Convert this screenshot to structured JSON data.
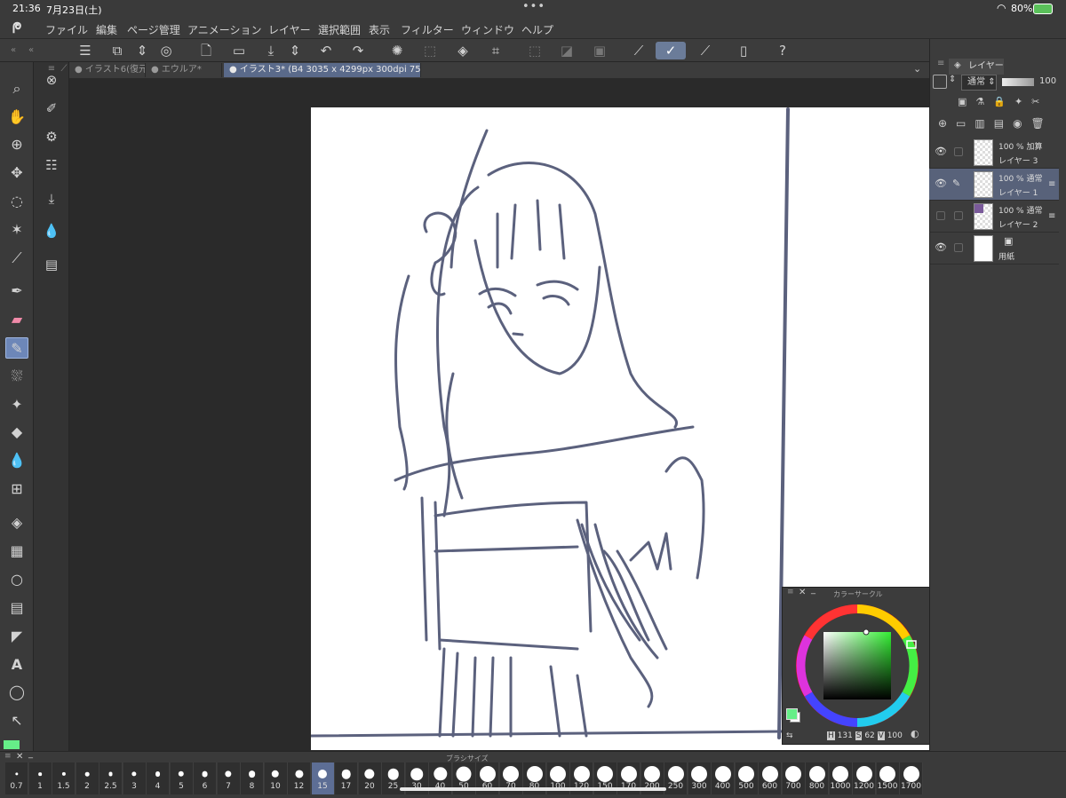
{
  "status": {
    "time": "21:36",
    "date": "7月23日(土)",
    "dots": "•••",
    "battery": "80%"
  },
  "menu": [
    "ファイル",
    "編集",
    "ページ管理",
    "アニメーション",
    "レイヤー",
    "選択範囲",
    "表示",
    "フィルター",
    "ウィンドウ",
    "ヘルプ"
  ],
  "tabs": [
    "イラスト6(復元",
    "エウルア*",
    "イラスト3* (B4 3035 x 4299px 300dpi 75.7%)"
  ],
  "layers_panel": {
    "tab_label": "レイヤー",
    "blend_mode": "通常",
    "opacity": "100",
    "layers": [
      {
        "opacity": "100 %",
        "mode": "加算",
        "name": "レイヤー 3",
        "visible": true,
        "selected": false
      },
      {
        "opacity": "100 %",
        "mode": "通常",
        "name": "レイヤー 1",
        "visible": true,
        "selected": true
      },
      {
        "opacity": "100 %",
        "mode": "通常",
        "name": "レイヤー 2",
        "visible": false,
        "selected": false
      },
      {
        "opacity": "",
        "mode": "",
        "name": "用紙",
        "visible": true,
        "selected": false
      }
    ]
  },
  "color_panel": {
    "title": "カラーサークル",
    "h_label": "H",
    "h": "131",
    "s_label": "S",
    "s": "62",
    "v_label": "V",
    "v": "100",
    "main_color": "#66ee88",
    "accent_square": "#3aa33a"
  },
  "brush_panel": {
    "title": "ブラシサイズ",
    "sizes": [
      "0.7",
      "1",
      "1.5",
      "2",
      "2.5",
      "3",
      "4",
      "5",
      "6",
      "7",
      "8",
      "10",
      "12",
      "15",
      "17",
      "20",
      "25",
      "30",
      "40",
      "50",
      "60",
      "70",
      "80",
      "100",
      "120",
      "150",
      "170",
      "200",
      "250",
      "300",
      "400",
      "500",
      "600",
      "700",
      "800",
      "1000",
      "1200",
      "1500",
      "1700"
    ],
    "selected": "15"
  },
  "icons": {
    "left_tools": [
      "zoom-icon",
      "hand-icon",
      "move-layer-icon",
      "move-icon",
      "lasso-icon",
      "magic-wand-icon",
      "eyedropper-icon",
      "pen-icon",
      "marker-icon",
      "pencil-icon",
      "airbrush-icon",
      "decoration-icon",
      "eraser-icon",
      "blend-icon",
      "mesh-icon",
      "fill-icon",
      "gradient-icon",
      "figure-icon",
      "frame-icon",
      "ruler-icon",
      "text-icon",
      "balloon-icon",
      "correct-line-icon"
    ]
  }
}
